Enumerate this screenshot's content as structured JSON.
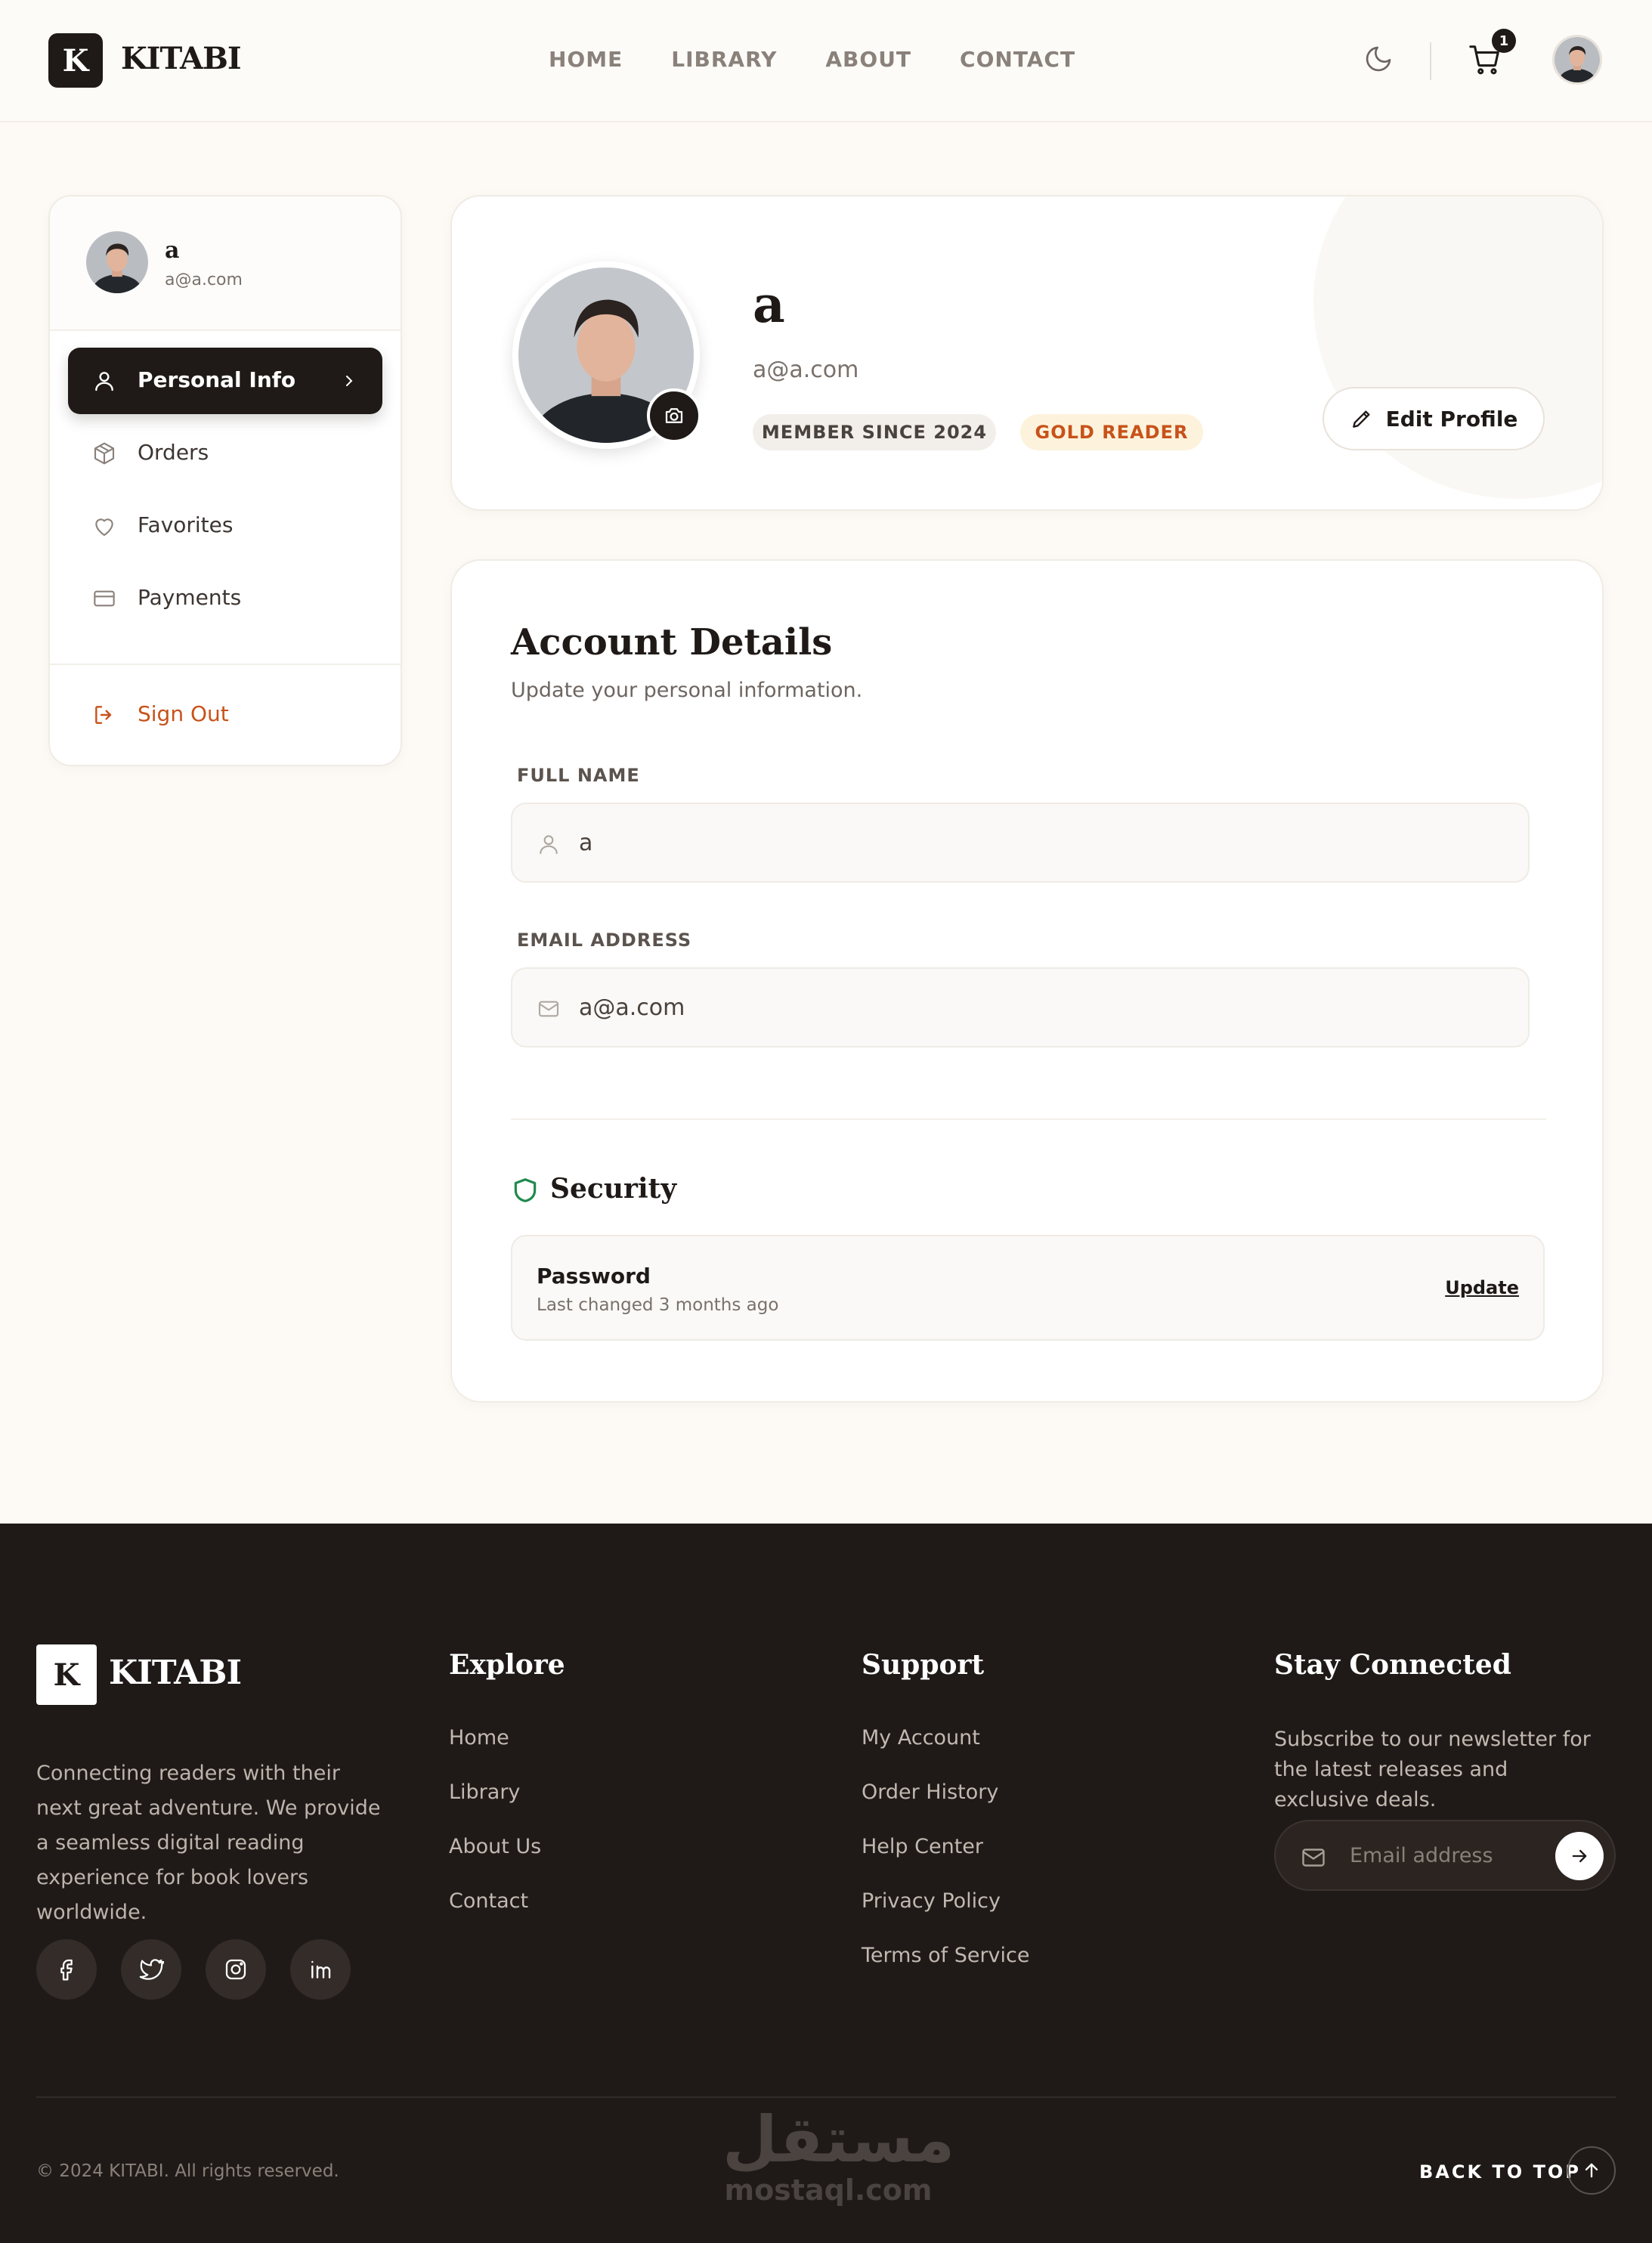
{
  "brand": {
    "logo_letter": "K",
    "name": "KITABI"
  },
  "nav": {
    "items": [
      "HOME",
      "LIBRARY",
      "ABOUT",
      "CONTACT"
    ]
  },
  "header": {
    "cart_count": "1"
  },
  "user": {
    "name": "a",
    "email": "a@a.com"
  },
  "sidebar": {
    "items": [
      {
        "label": "Personal Info",
        "icon": "user-icon",
        "active": true
      },
      {
        "label": "Orders",
        "icon": "box-icon"
      },
      {
        "label": "Favorites",
        "icon": "heart-icon"
      },
      {
        "label": "Payments",
        "icon": "credit-card-icon"
      }
    ],
    "sign_out": "Sign Out"
  },
  "profile": {
    "badge_member": "MEMBER SINCE 2024",
    "badge_tier": "GOLD READER",
    "edit_label": "Edit Profile"
  },
  "account": {
    "title": "Account Details",
    "subtitle": "Update your personal information.",
    "full_name_label": "FULL NAME",
    "full_name_value": "a",
    "email_label": "EMAIL ADDRESS",
    "email_value": "a@a.com"
  },
  "security": {
    "title": "Security",
    "password_title": "Password",
    "password_sub": "Last changed 3 months ago",
    "update_label": "Update"
  },
  "footer": {
    "description": "Connecting readers with their next great adventure. We provide a seamless digital reading experience for book lovers worldwide.",
    "explore_title": "Explore",
    "explore_links": [
      "Home",
      "Library",
      "About Us",
      "Contact"
    ],
    "support_title": "Support",
    "support_links": [
      "My Account",
      "Order History",
      "Help Center",
      "Privacy Policy",
      "Terms of Service"
    ],
    "stay_title": "Stay Connected",
    "stay_text": "Subscribe to our newsletter for the latest releases and exclusive deals.",
    "email_placeholder": "Email address",
    "copyright": "© 2024 KITABI. All rights reserved.",
    "back_to_top": "BACK TO TOP",
    "watermark_ar": "مستقل",
    "watermark_en": "mostaql.com"
  },
  "colors": {
    "dark": "#1f1a17",
    "accent_orange": "#c8521a",
    "security_green": "#1e8a4c",
    "cream_bg": "#fdfaf5"
  }
}
